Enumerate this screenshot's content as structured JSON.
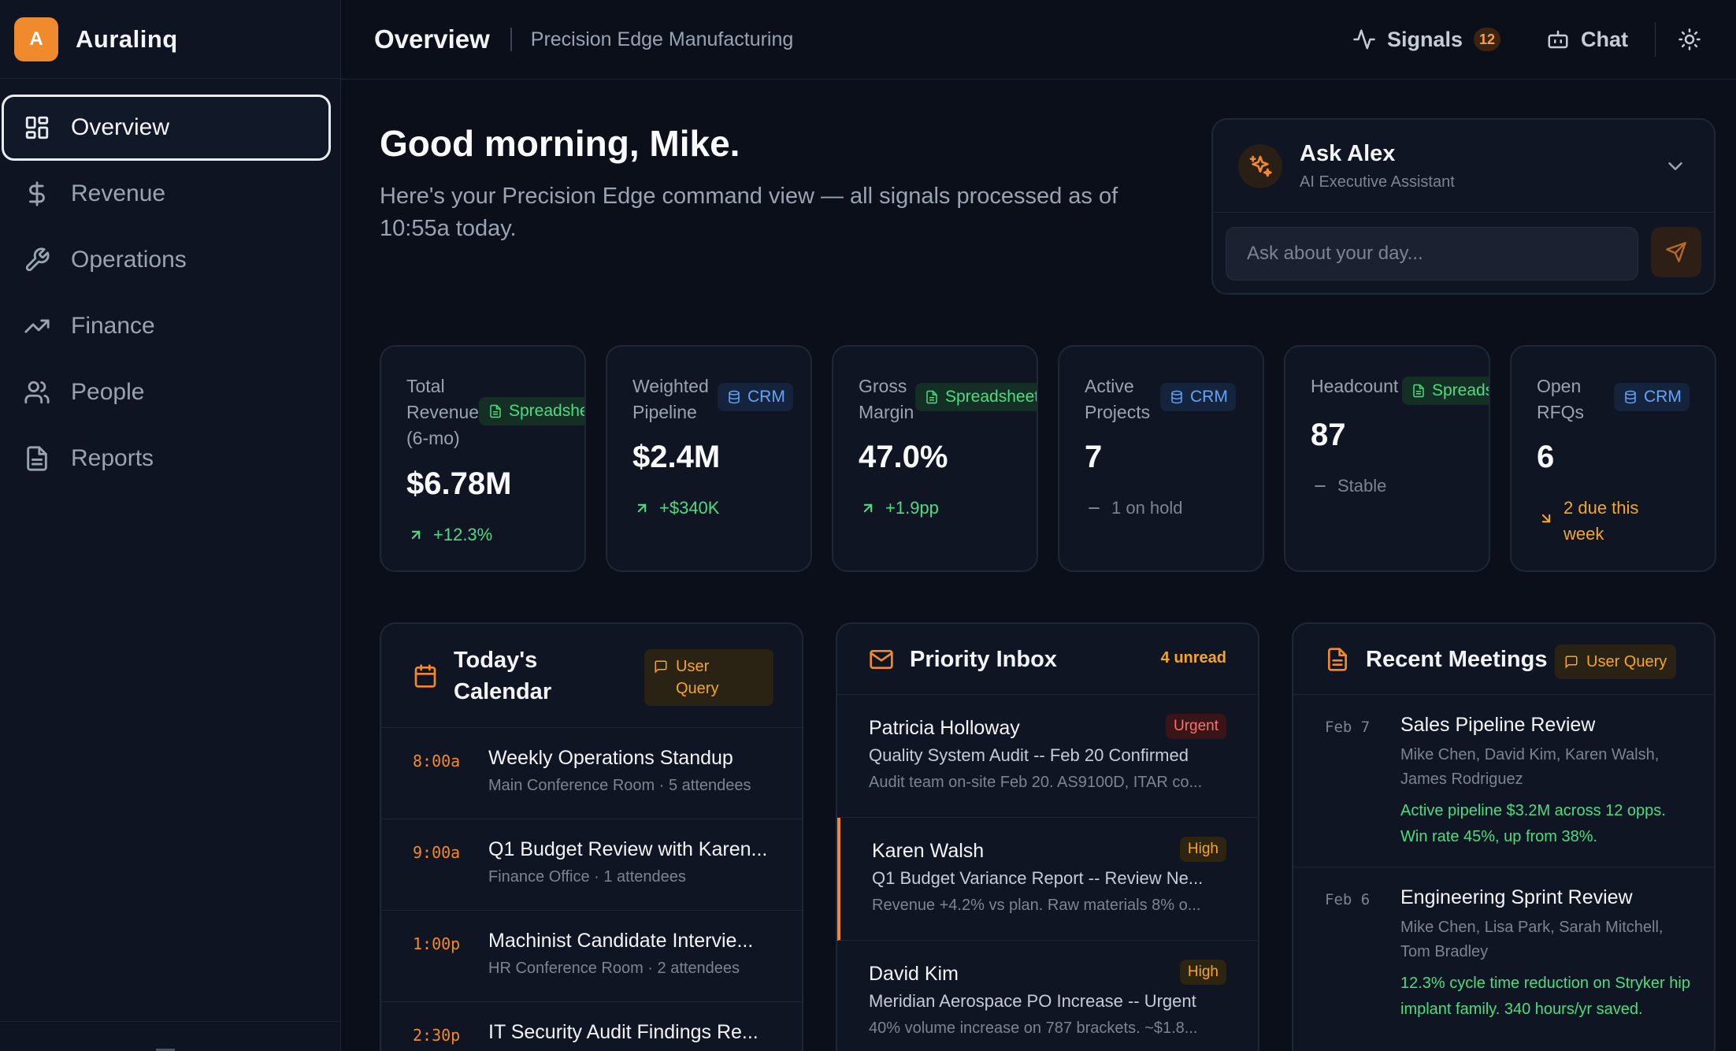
{
  "brand": {
    "logo_letter": "A",
    "name": "Auralinq"
  },
  "sidebar": {
    "items": [
      {
        "label": "Overview",
        "icon": "grid-icon",
        "active": true
      },
      {
        "label": "Revenue",
        "icon": "dollar-icon",
        "active": false
      },
      {
        "label": "Operations",
        "icon": "wrench-icon",
        "active": false
      },
      {
        "label": "Finance",
        "icon": "trending-up-icon",
        "active": false
      },
      {
        "label": "People",
        "icon": "users-icon",
        "active": false
      },
      {
        "label": "Reports",
        "icon": "document-icon",
        "active": false
      }
    ]
  },
  "topbar": {
    "title": "Overview",
    "company": "Precision Edge Manufacturing",
    "signals_label": "Signals",
    "signals_count": "12",
    "chat_label": "Chat"
  },
  "greeting": {
    "title": "Good morning, Mike.",
    "subtitle": "Here's your Precision Edge command view — all signals processed as of 10:55a today."
  },
  "ask": {
    "name": "Ask Alex",
    "role": "AI Executive Assistant",
    "placeholder": "Ask about your day..."
  },
  "kpis": [
    {
      "label": "Total Revenue (6-mo)",
      "tag": "Spreadsheet",
      "tag_type": "sheet",
      "value": "$6.78M",
      "delta": "+12.3%",
      "trend": "up"
    },
    {
      "label": "Weighted Pipeline",
      "tag": "CRM",
      "tag_type": "crm",
      "value": "$2.4M",
      "delta": "+$340K",
      "trend": "up"
    },
    {
      "label": "Gross Margin",
      "tag": "Spreadsheet",
      "tag_type": "sheet",
      "value": "47.0%",
      "delta": "+1.9pp",
      "trend": "up"
    },
    {
      "label": "Active Projects",
      "tag": "CRM",
      "tag_type": "crm",
      "value": "7",
      "delta": "1 on hold",
      "trend": "flat"
    },
    {
      "label": "Headcount",
      "tag": "Spreadsheet",
      "tag_type": "sheet",
      "value": "87",
      "delta": "Stable",
      "trend": "flat"
    },
    {
      "label": "Open RFQs",
      "tag": "CRM",
      "tag_type": "crm",
      "value": "6",
      "delta": "2 due this week",
      "trend": "down"
    }
  ],
  "calendar": {
    "title": "Today's Calendar",
    "tag": "User Query",
    "events": [
      {
        "time": "8:00a",
        "title": "Weekly Operations Standup",
        "meta": "Main Conference Room · 5 attendees"
      },
      {
        "time": "9:00a",
        "title": "Q1 Budget Review with Karen...",
        "meta": "Finance Office · 1 attendees"
      },
      {
        "time": "1:00p",
        "title": "Machinist Candidate Intervie...",
        "meta": "HR Conference Room · 2 attendees"
      },
      {
        "time": "2:30p",
        "title": "IT Security Audit Findings Re...",
        "meta": ""
      }
    ]
  },
  "inbox": {
    "title": "Priority Inbox",
    "unread": "4 unread",
    "messages": [
      {
        "from": "Patricia Holloway",
        "priority": "Urgent",
        "subject": "Quality System Audit -- Feb 20 Confirmed",
        "preview": "Audit team on-site Feb 20. AS9100D, ITAR co..."
      },
      {
        "from": "Karen Walsh",
        "priority": "High",
        "subject": "Q1 Budget Variance Report -- Review Ne...",
        "preview": "Revenue +4.2% vs plan. Raw materials 8% o..."
      },
      {
        "from": "David Kim",
        "priority": "High",
        "subject": "Meridian Aerospace PO Increase -- Urgent",
        "preview": "40% volume increase on 787 brackets. ~$1.8..."
      }
    ]
  },
  "meetings": {
    "title": "Recent Meetings",
    "tag": "User Query",
    "items": [
      {
        "date": "Feb 7",
        "title": "Sales Pipeline Review",
        "people": "Mike Chen, David Kim, Karen Walsh, James Rodriguez",
        "note": "Active pipeline $3.2M across 12 opps. Win rate 45%, up from 38%."
      },
      {
        "date": "Feb 6",
        "title": "Engineering Sprint Review",
        "people": "Mike Chen, Lisa Park, Sarah Mitchell, Tom Bradley",
        "note": "12.3% cycle time reduction on Stryker hip implant family. 340 hours/yr saved."
      }
    ]
  },
  "colors": {
    "accent": "#f08a2c",
    "background": "#0b0f1a",
    "positive": "#4ade80",
    "warning": "#f5a623",
    "urgent": "#f87171",
    "crm": "#60a5fa"
  }
}
